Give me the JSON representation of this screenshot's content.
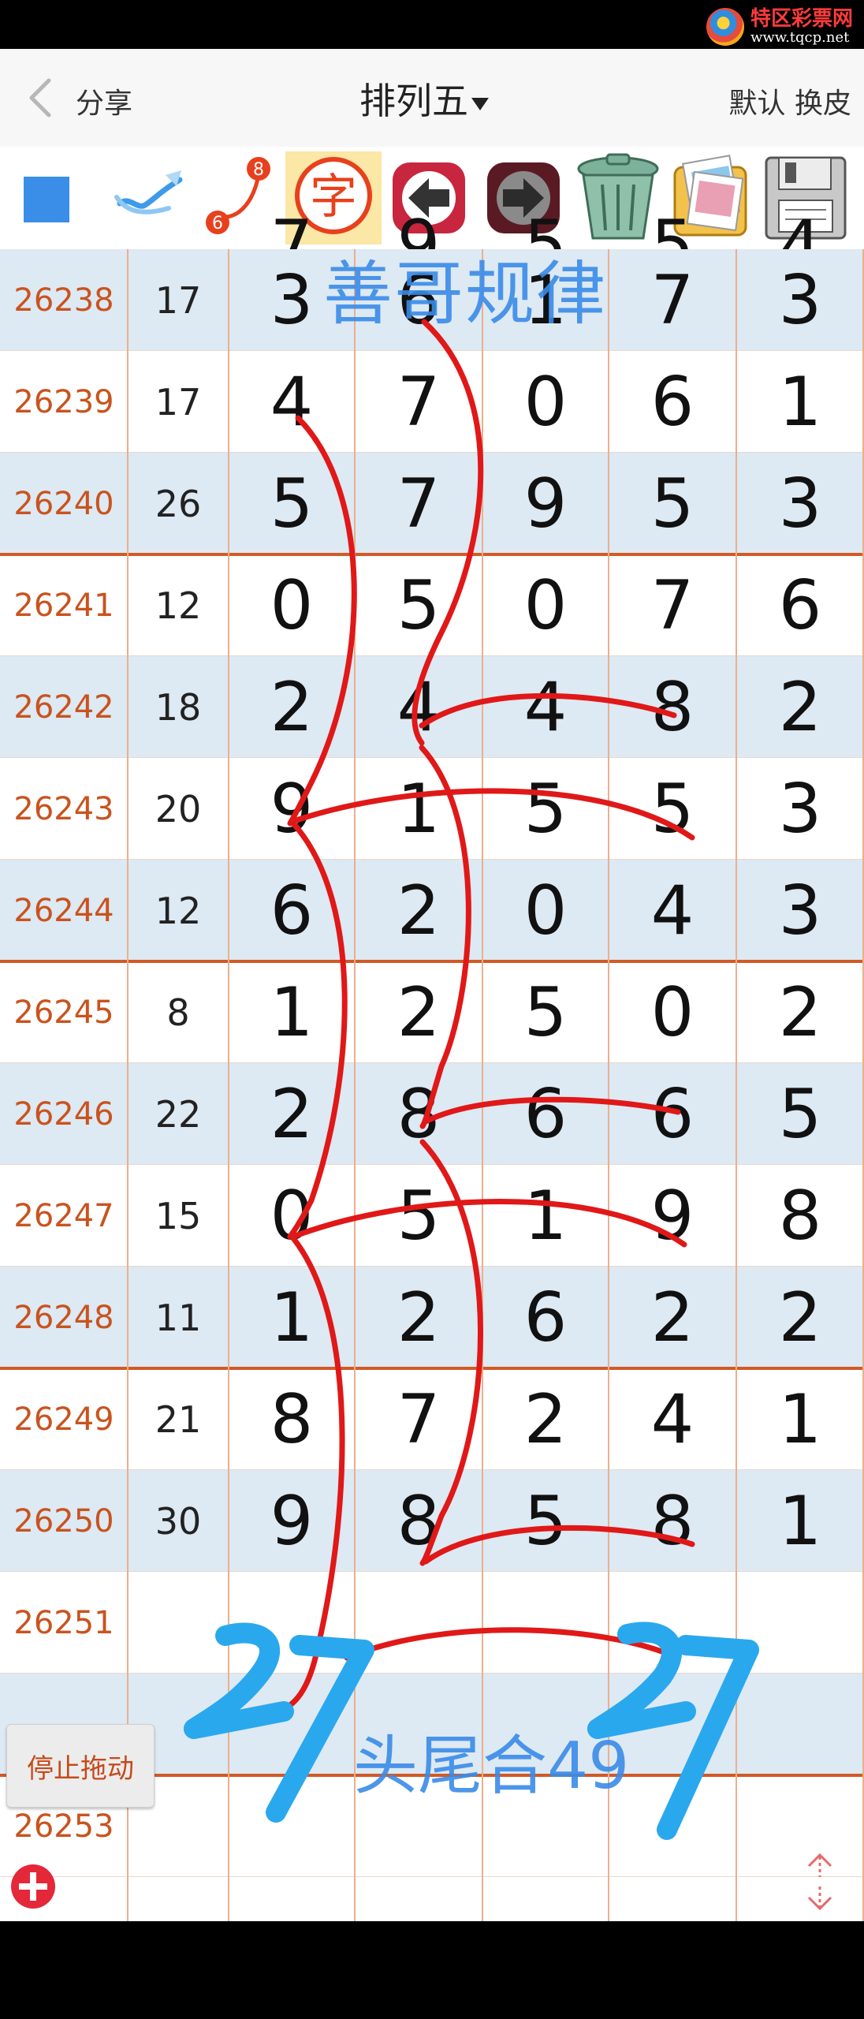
{
  "watermark": {
    "site_name": "特区彩票网",
    "site_url": "www.tqcp.net"
  },
  "header": {
    "back_label": "分享",
    "title": "排列五",
    "skin_label": "默认 换皮"
  },
  "toolbar": {
    "char_icon_label": "字",
    "badge_top": "8",
    "badge_bottom": "6"
  },
  "annotations": {
    "top_text": "善哥规律",
    "bottom_text": "头尾合49",
    "hand_left": "27",
    "hand_right": "27"
  },
  "rows": [
    {
      "issue": "26238",
      "sum": "17",
      "d": [
        "3",
        "6",
        "1",
        "7",
        "3"
      ]
    },
    {
      "issue": "26239",
      "sum": "17",
      "d": [
        "4",
        "7",
        "0",
        "6",
        "1"
      ]
    },
    {
      "issue": "26240",
      "sum": "26",
      "d": [
        "5",
        "7",
        "9",
        "5",
        "3"
      ]
    },
    {
      "issue": "26241",
      "sum": "12",
      "d": [
        "0",
        "5",
        "0",
        "7",
        "6"
      ]
    },
    {
      "issue": "26242",
      "sum": "18",
      "d": [
        "2",
        "4",
        "4",
        "8",
        "2"
      ]
    },
    {
      "issue": "26243",
      "sum": "20",
      "d": [
        "9",
        "1",
        "5",
        "5",
        "3"
      ]
    },
    {
      "issue": "26244",
      "sum": "12",
      "d": [
        "6",
        "2",
        "0",
        "4",
        "3"
      ]
    },
    {
      "issue": "26245",
      "sum": "8",
      "d": [
        "1",
        "2",
        "5",
        "0",
        "2"
      ]
    },
    {
      "issue": "26246",
      "sum": "22",
      "d": [
        "2",
        "8",
        "6",
        "6",
        "5"
      ]
    },
    {
      "issue": "26247",
      "sum": "15",
      "d": [
        "0",
        "5",
        "1",
        "9",
        "8"
      ]
    },
    {
      "issue": "26248",
      "sum": "11",
      "d": [
        "1",
        "2",
        "6",
        "2",
        "2"
      ]
    },
    {
      "issue": "26249",
      "sum": "21",
      "d": [
        "8",
        "7",
        "2",
        "4",
        "1"
      ]
    },
    {
      "issue": "26250",
      "sum": "30",
      "d": [
        "9",
        "8",
        "5",
        "8",
        "1"
      ]
    },
    {
      "issue": "26251",
      "sum": "",
      "d": [
        "",
        "",
        "",
        "",
        ""
      ]
    },
    {
      "issue": "",
      "sum": "",
      "d": [
        "",
        "",
        "",
        "",
        ""
      ]
    },
    {
      "issue": "26253",
      "sum": "",
      "d": [
        "",
        "",
        "",
        "",
        ""
      ]
    }
  ],
  "controls": {
    "stop_drag_label": "停止拖动"
  },
  "colors": {
    "issue": "#c9531e",
    "separator": "#d25a25",
    "alt_row": "#dde9f3",
    "pen_red": "#e01818",
    "pen_blue": "#2aa8ee"
  }
}
